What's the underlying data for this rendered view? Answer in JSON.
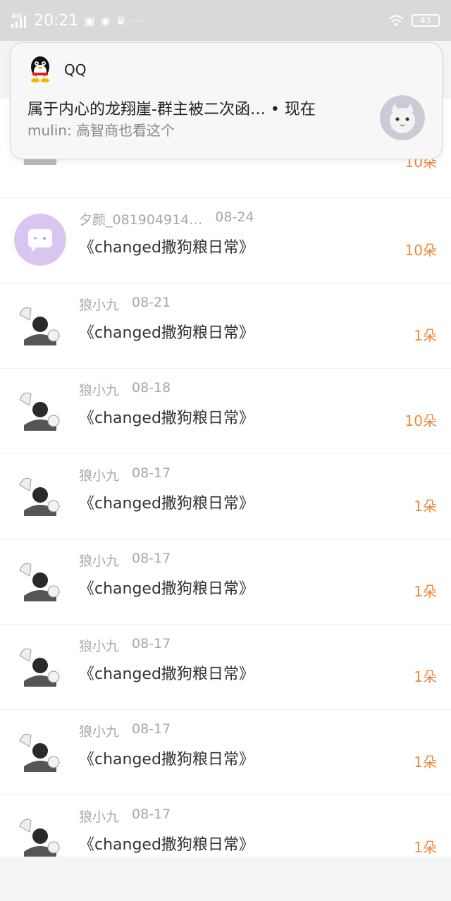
{
  "status_bar": {
    "network": "4G",
    "time": "20:21",
    "icons": [
      "status-icon-1",
      "status-icon-2",
      "crown-icon",
      "more-dots-icon"
    ],
    "more": "···",
    "battery": "43"
  },
  "notification": {
    "app_name": "QQ",
    "title": "属于内心的龙翔崖-群主被二次函… • 现在",
    "body": "mulin: 高智商也看这个"
  },
  "list": {
    "items": [
      {
        "user": "",
        "date": "",
        "title": "",
        "gift": ""
      },
      {
        "user": "夕颜_081904914…",
        "date": "08-24",
        "title": "《changed撒狗粮日常》",
        "gift": "10朵",
        "avatar": "chat-bubble"
      },
      {
        "user": "狼小九",
        "date": "08-21",
        "title": "《changed撒狗粮日常》",
        "gift": "1朵",
        "avatar": "anime"
      },
      {
        "user": "狼小九",
        "date": "08-18",
        "title": "《changed撒狗粮日常》",
        "gift": "10朵",
        "avatar": "anime"
      },
      {
        "user": "狼小九",
        "date": "08-17",
        "title": "《changed撒狗粮日常》",
        "gift": "1朵",
        "avatar": "anime"
      },
      {
        "user": "狼小九",
        "date": "08-17",
        "title": "《changed撒狗粮日常》",
        "gift": "1朵",
        "avatar": "anime"
      },
      {
        "user": "狼小九",
        "date": "08-17",
        "title": "《changed撒狗粮日常》",
        "gift": "1朵",
        "avatar": "anime"
      },
      {
        "user": "狼小九",
        "date": "08-17",
        "title": "《changed撒狗粮日常》",
        "gift": "1朵",
        "avatar": "anime"
      },
      {
        "user": "狼小九",
        "date": "08-17",
        "title": "《changed撒狗粮日常》",
        "gift": "1朵",
        "avatar": "anime"
      }
    ]
  },
  "colors": {
    "gift_orange": "#f0883a",
    "meta_gray": "#a8a8a8",
    "bubble_purple": "#d9c6f0"
  }
}
